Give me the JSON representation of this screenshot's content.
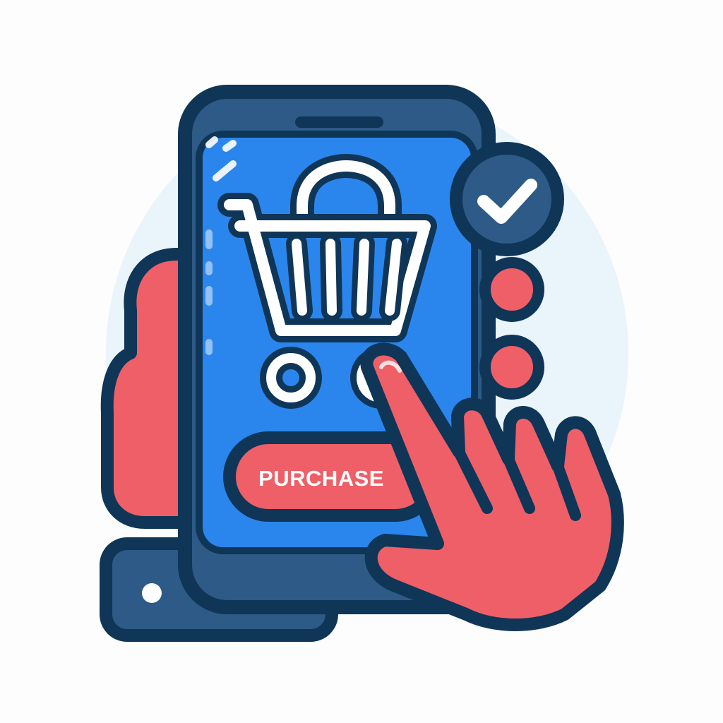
{
  "purchase_button": {
    "label": "PURCHASE"
  },
  "icons": {
    "cart": "shopping-cart-icon",
    "check": "checkmark-icon",
    "hand": "pointing-hand-icon",
    "phone": "smartphone-icon"
  },
  "colors": {
    "outline": "#0f3557",
    "screen": "#2a86ec",
    "phone_body": "#2d5a86",
    "hand": "#ee5f67",
    "button": "#ee5f67",
    "button_text": "#ffffff",
    "backdrop": "#e9f4fb",
    "check_badge": "#2d5a86"
  }
}
